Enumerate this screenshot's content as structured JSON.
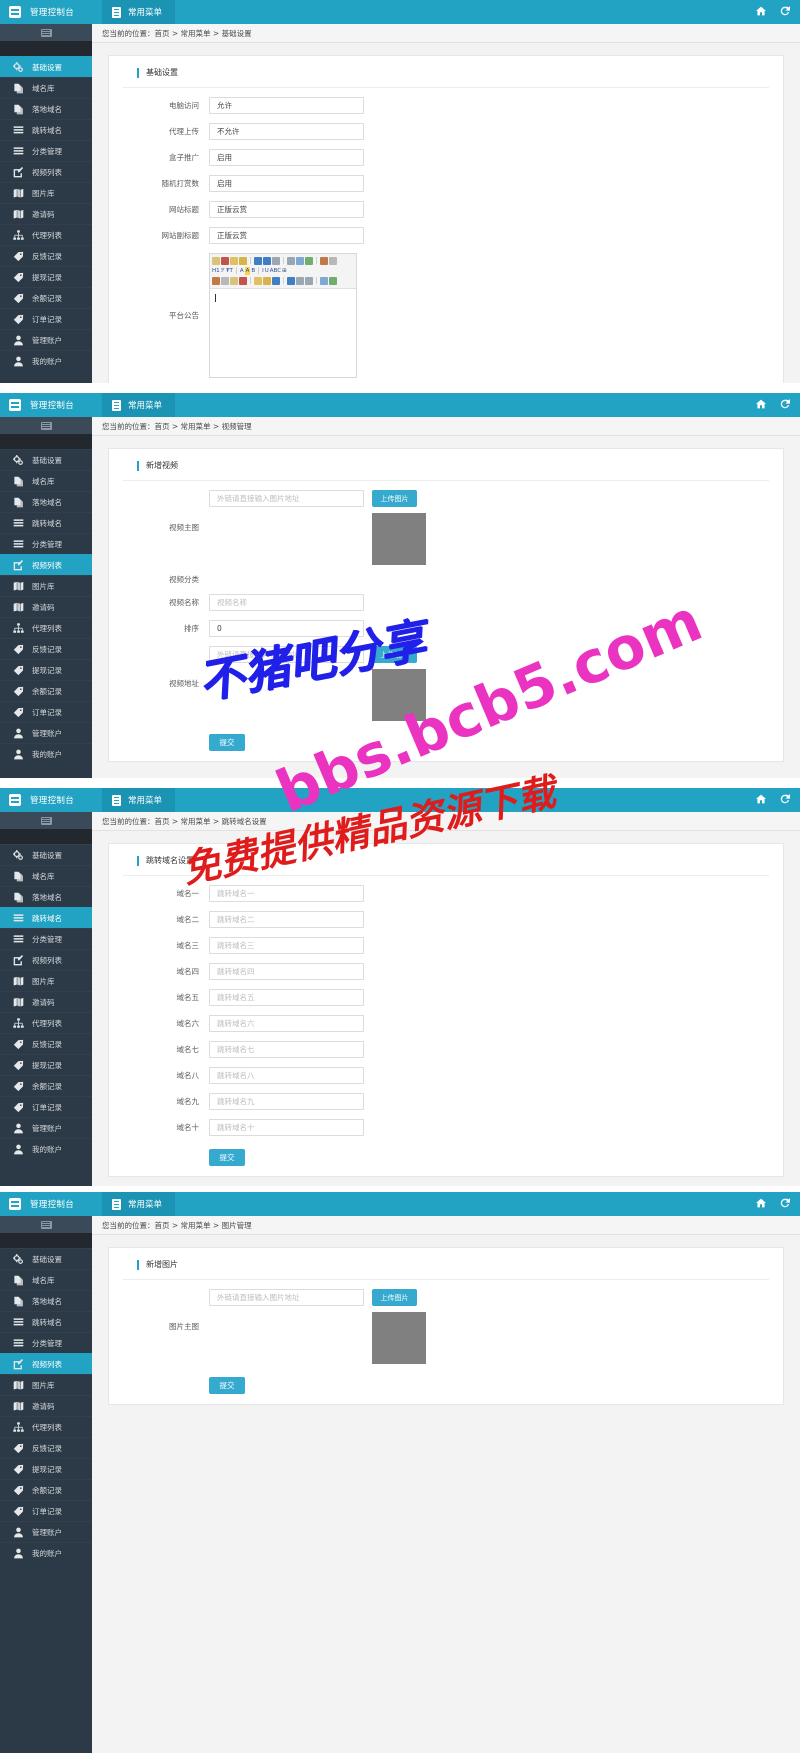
{
  "topbar": {
    "brand": "管理控制台",
    "menu": "常用菜单",
    "home_icon": "home-icon",
    "refresh_icon": "refresh-icon"
  },
  "sidebar": {
    "items": [
      {
        "label": "基础设置",
        "icon": "settings-gears-icon"
      },
      {
        "label": "域名库",
        "icon": "copy-files-icon"
      },
      {
        "label": "落地域名",
        "icon": "copy-files-icon"
      },
      {
        "label": "跳转域名",
        "icon": "list-lines-icon"
      },
      {
        "label": "分类管理",
        "icon": "list-lines-icon"
      },
      {
        "label": "视频列表",
        "icon": "edit-pencil-icon"
      },
      {
        "label": "图片库",
        "icon": "book-open-icon"
      },
      {
        "label": "邀请码",
        "icon": "book-open-icon"
      },
      {
        "label": "代理列表",
        "icon": "sitemap-icon"
      },
      {
        "label": "反馈记录",
        "icon": "tag-icon"
      },
      {
        "label": "提现记录",
        "icon": "tag-icon"
      },
      {
        "label": "余额记录",
        "icon": "tag-icon"
      },
      {
        "label": "订单记录",
        "icon": "tag-icon"
      },
      {
        "label": "管理账户",
        "icon": "user-icon"
      },
      {
        "label": "我的账户",
        "icon": "user-icon"
      }
    ]
  },
  "panels": [
    {
      "id": "basic-settings",
      "breadcrumb": "您当前的位置：首页 > 常用菜单 > 基础设置",
      "active_item": "基础设置",
      "card_title": "基础设置",
      "fields": [
        {
          "label": "电脑访问",
          "type": "select",
          "value": "允许"
        },
        {
          "label": "代理上传",
          "type": "select",
          "value": "不允许"
        },
        {
          "label": "盒子推广",
          "type": "select",
          "value": "启用"
        },
        {
          "label": "随机打赏数",
          "type": "select",
          "value": "启用"
        },
        {
          "label": "网站标题",
          "type": "input",
          "value": "正版云赏"
        },
        {
          "label": "网站副标题",
          "type": "input",
          "value": "正版云赏"
        },
        {
          "label": "平台公告",
          "type": "editor",
          "value": ""
        }
      ],
      "editor_toolbar_rows": [
        [
          "H1",
          "ℱ",
          "₮T",
          "A",
          "A",
          "B",
          "I",
          "U",
          "ABC"
        ],
        [
          "",
          "",
          "",
          "",
          "",
          "",
          "",
          ""
        ]
      ]
    },
    {
      "id": "video-management",
      "breadcrumb": "您当前的位置：首页 > 常用菜单 > 视频管理",
      "active_item": "视频列表",
      "card_title": "新增视频",
      "fields": [
        {
          "label": "视频主图",
          "type": "upload",
          "placeholder": "外链请直接输入图片地址",
          "button": "上传图片"
        },
        {
          "label": "视频分类",
          "type": "bare",
          "value": ""
        },
        {
          "label": "视频名称",
          "type": "input",
          "placeholder": "视频名称",
          "value": ""
        },
        {
          "label": "排序",
          "type": "input",
          "value": "0"
        },
        {
          "label": "视频地址",
          "type": "upload",
          "placeholder": "外链请直接输入视频地址",
          "button": "上传视频"
        }
      ],
      "submit": "提交"
    },
    {
      "id": "redirect-domains",
      "breadcrumb": "您当前的位置：首页 > 常用菜单 > 跳转域名设置",
      "active_item": "跳转域名",
      "card_title": "跳转域名设置",
      "fields": [
        {
          "label": "域名一",
          "type": "input",
          "placeholder": "跳转域名一"
        },
        {
          "label": "域名二",
          "type": "input",
          "placeholder": "跳转域名二"
        },
        {
          "label": "域名三",
          "type": "input",
          "placeholder": "跳转域名三"
        },
        {
          "label": "域名四",
          "type": "input",
          "placeholder": "跳转域名四"
        },
        {
          "label": "域名五",
          "type": "input",
          "placeholder": "跳转域名五"
        },
        {
          "label": "域名六",
          "type": "input",
          "placeholder": "跳转域名六"
        },
        {
          "label": "域名七",
          "type": "input",
          "placeholder": "跳转域名七"
        },
        {
          "label": "域名八",
          "type": "input",
          "placeholder": "跳转域名八"
        },
        {
          "label": "域名九",
          "type": "input",
          "placeholder": "跳转域名九"
        },
        {
          "label": "域名十",
          "type": "input",
          "placeholder": "跳转域名十"
        }
      ],
      "submit": "提交"
    },
    {
      "id": "image-management",
      "breadcrumb": "您当前的位置：首页 > 常用菜单 > 图片管理",
      "active_item": "视频列表",
      "card_title": "新增图片",
      "fields": [
        {
          "label": "图片主图",
          "type": "upload",
          "placeholder": "外链请直接输入图片地址",
          "button": "上传图片"
        }
      ],
      "submit": "提交"
    }
  ],
  "watermarks": {
    "blue_text": "不猪吧分享",
    "pink_text": "bbs.bcb5.com",
    "red_text": "免费提供精品资源下载"
  },
  "colors": {
    "accent": "#22A3C3",
    "button": "#35A9CE",
    "sidebar_bg": "#2C3A47",
    "sidebar_active": "#22A3C3",
    "watermark_blue": "#2020E8",
    "watermark_pink": "#EA33C0",
    "watermark_red": "#E01B1B"
  }
}
